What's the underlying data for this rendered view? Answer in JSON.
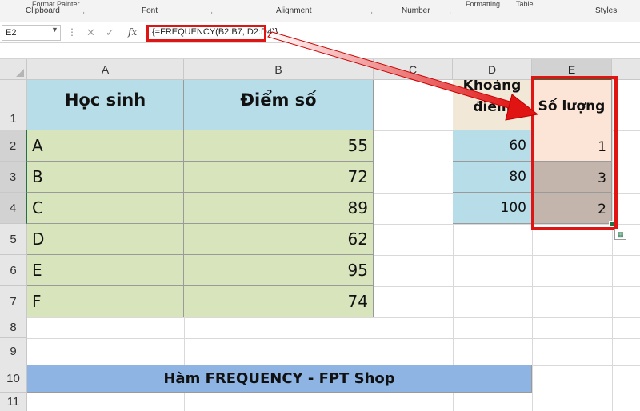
{
  "ribbon": {
    "format_painter": "Format Painter",
    "formatting": "Formatting",
    "table": "Table",
    "groups": [
      "Clipboard",
      "Font",
      "Alignment",
      "Number",
      "Styles"
    ]
  },
  "formula_bar": {
    "name_box": "E2",
    "fx": "fx",
    "formula": "{=FREQUENCY(B2:B7, D2:D4)}"
  },
  "columns": [
    "A",
    "B",
    "C",
    "D",
    "E"
  ],
  "rows": [
    "1",
    "2",
    "3",
    "4",
    "5",
    "6",
    "7",
    "8",
    "9",
    "10",
    "11"
  ],
  "table_left": {
    "headers": [
      "Học sinh",
      "Điểm số"
    ],
    "rows": [
      {
        "name": "A",
        "score": "55"
      },
      {
        "name": "B",
        "score": "72"
      },
      {
        "name": "C",
        "score": "89"
      },
      {
        "name": "D",
        "score": "62"
      },
      {
        "name": "E",
        "score": "95"
      },
      {
        "name": "F",
        "score": "74"
      }
    ]
  },
  "table_right": {
    "d_header_line1": "Khoảng",
    "d_header_line2": "điểm",
    "e_header": "Số lượng",
    "rows": [
      {
        "bin": "60",
        "count": "1"
      },
      {
        "bin": "80",
        "count": "3"
      },
      {
        "bin": "100",
        "count": "2"
      }
    ]
  },
  "banner": "Hàm FREQUENCY - FPT Shop",
  "colors": {
    "header_blue": "#b7dde8",
    "data_green": "#d8e4bc",
    "highlight_red": "#e11414",
    "banner_blue": "#8db4e2",
    "excel_green": "#217346"
  }
}
